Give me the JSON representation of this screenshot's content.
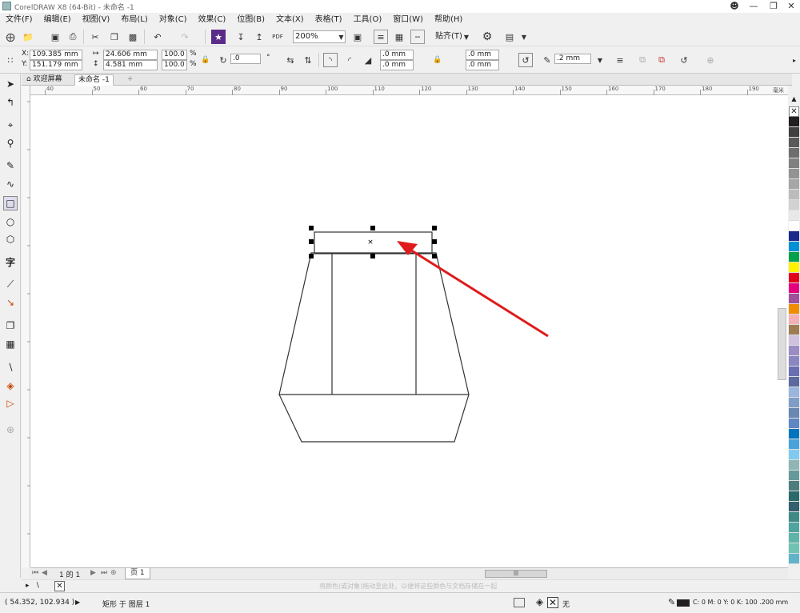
{
  "window": {
    "title": "CorelDRAW X8 (64-Bit) - 未命名 -1"
  },
  "menu": [
    "文件(F)",
    "编辑(E)",
    "视图(V)",
    "布局(L)",
    "对象(C)",
    "效果(C)",
    "位图(B)",
    "文本(X)",
    "表格(T)",
    "工具(O)",
    "窗口(W)",
    "帮助(H)"
  ],
  "toolbar": {
    "zoom": "200%",
    "snap_label": "贴齐(T)"
  },
  "properties": {
    "x": "109.385 mm",
    "y": "151.179 mm",
    "w": "24.606 mm",
    "h": "4.581 mm",
    "scale_x": "100.0",
    "scale_y": "100.0",
    "pct": "%",
    "rotation": ".0",
    "corner1": ".0 mm",
    "corner2": ".0 mm",
    "corner3": ".0 mm",
    "corner4": ".0 mm",
    "outline": ".2 mm",
    "x_label": "X:",
    "y_label": "Y:"
  },
  "tabs": {
    "welcome": "欢迎屏幕",
    "doc": "未命名 -1",
    "add": "+"
  },
  "ruler": {
    "h_ticks": [
      "40",
      "50",
      "60",
      "70",
      "80",
      "90",
      "100",
      "110",
      "120",
      "130",
      "140",
      "150",
      "160",
      "170",
      "180",
      "190"
    ],
    "unit": "毫米"
  },
  "page_nav": {
    "page_info": "1 的 1",
    "page_tab": "页 1"
  },
  "colorbar_hint": "将颜色(或对象)拖动至此处，以便将这些颜色与文档存储在一起",
  "status": {
    "coords": "( 54.352, 102.934 )",
    "object": "矩形 于 图层 1",
    "fill_none": "无",
    "outline_info": "C: 0 M: 0 Y: 0 K: 100  .200 mm"
  },
  "palette": [
    "#231f20",
    "#404040",
    "#595959",
    "#6e6e6e",
    "#808080",
    "#939393",
    "#a6a6a6",
    "#bcbcbc",
    "#d2d2d2",
    "#e8e8e8",
    "#ffffff",
    "#1b2a8a",
    "#0091d4",
    "#00a14b",
    "#fff100",
    "#e2001a",
    "#e4007f",
    "#a0519b",
    "#f18d00",
    "#f4b0b5",
    "#a07c53",
    "#cfc1e0",
    "#9b8cc4",
    "#8a86c1",
    "#6a6fb2",
    "#5d6aa0",
    "#9bb6de",
    "#7e9ec7",
    "#6987b3",
    "#5f87c4",
    "#0074bc",
    "#49a3da",
    "#7fcaf0",
    "#8fb6b3",
    "#66999a",
    "#4c7d7c",
    "#2b6a6c",
    "#31606f",
    "#3f8a87",
    "#4ea49e",
    "#5fb4a9",
    "#6fc3b4",
    "#60b3c9"
  ]
}
